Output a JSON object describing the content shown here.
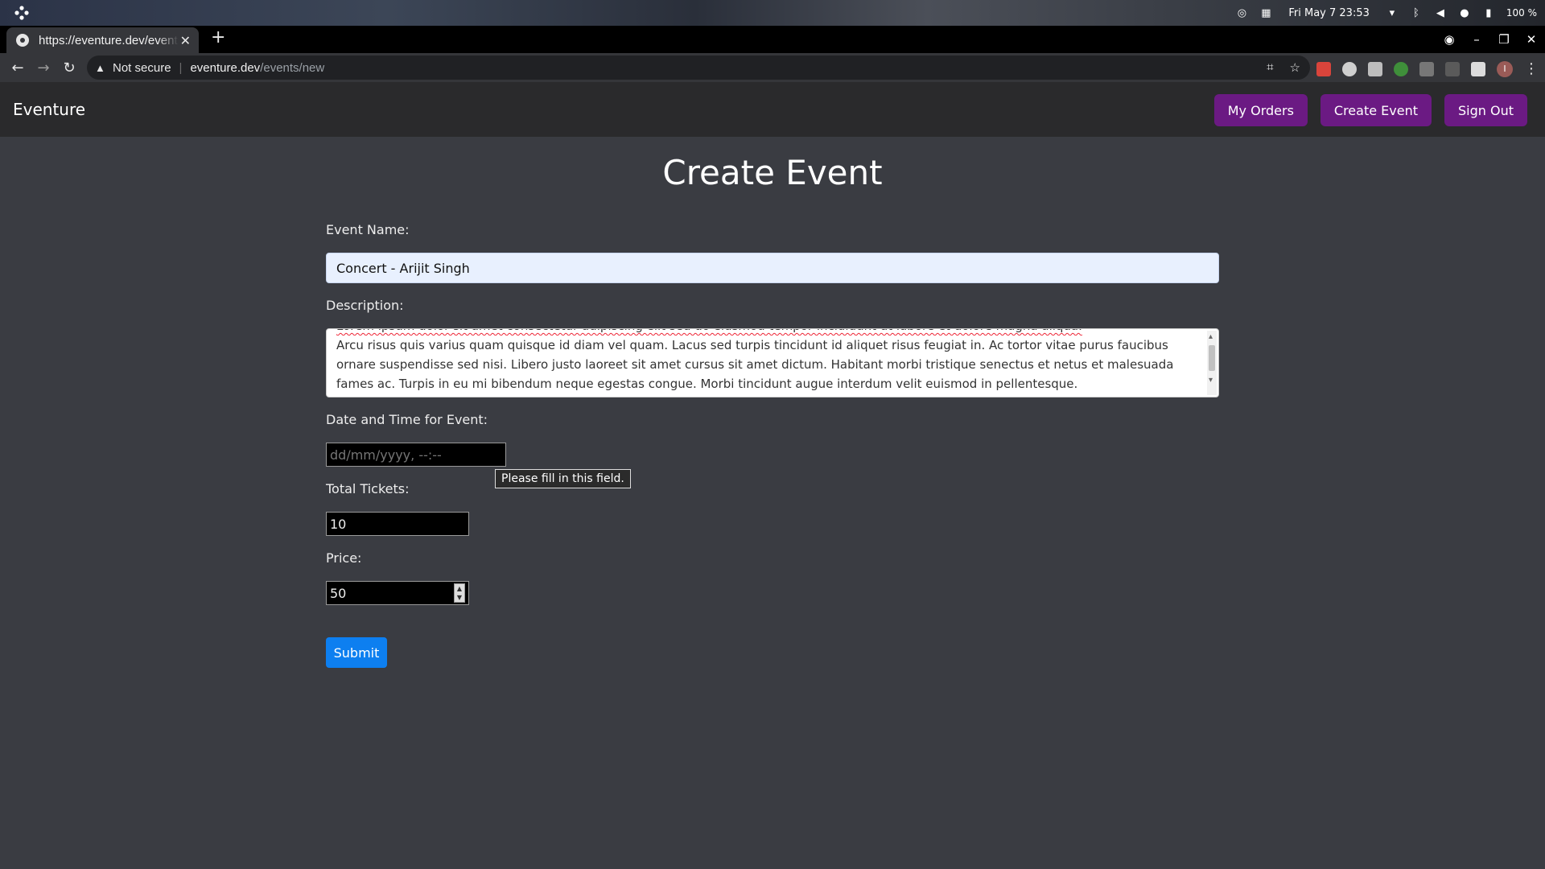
{
  "os": {
    "clock": "Fri May 7  23:53",
    "battery": "100 %",
    "icons": [
      "activities-icon",
      "obs-icon",
      "screen-icon",
      "wifi-icon",
      "bluetooth-icon",
      "volume-icon",
      "mic-icon",
      "battery-icon"
    ]
  },
  "browser": {
    "tab_title": "https://eventure.dev/events/new",
    "tab_close": "✕",
    "new_tab": "+",
    "security_label": "Not secure",
    "url_host": "eventure.dev",
    "url_path": "/events/new",
    "avatar_letter": "I"
  },
  "navbar": {
    "brand": "Eventure",
    "buttons": {
      "my_orders": "My Orders",
      "create_event": "Create Event",
      "sign_out": "Sign Out"
    },
    "button_color": "#6b1a83"
  },
  "page": {
    "title": "Create Event"
  },
  "form": {
    "event_name": {
      "label": "Event Name:",
      "value": "Concert - Arijit Singh"
    },
    "description": {
      "label": "Description:",
      "hidden_line": "Lorem ipsum dolor sit amet consectetur adipiscing elit sed do eiusmod tempor incididunt ut labore et dolore magna aliqua.",
      "value": "Arcu risus quis varius quam quisque id diam vel quam. Lacus sed turpis tincidunt id aliquet risus feugiat in. Ac tortor vitae purus faucibus ornare suspendisse sed nisi. Libero justo laoreet sit amet cursus sit amet dictum. Habitant morbi tristique senectus et netus et malesuada fames ac. Turpis in eu mi bibendum neque egestas congue. Morbi tincidunt augue interdum velit euismod in pellentesque."
    },
    "datetime": {
      "label": "Date and Time for Event:",
      "placeholder": "dd/mm/yyyy, --:--",
      "validation": "Please fill in this field."
    },
    "tickets": {
      "label": "Total Tickets:",
      "value": "10"
    },
    "price": {
      "label": "Price:",
      "value": "50"
    },
    "submit": {
      "label": "Submit",
      "color": "#0d7ff0"
    }
  }
}
